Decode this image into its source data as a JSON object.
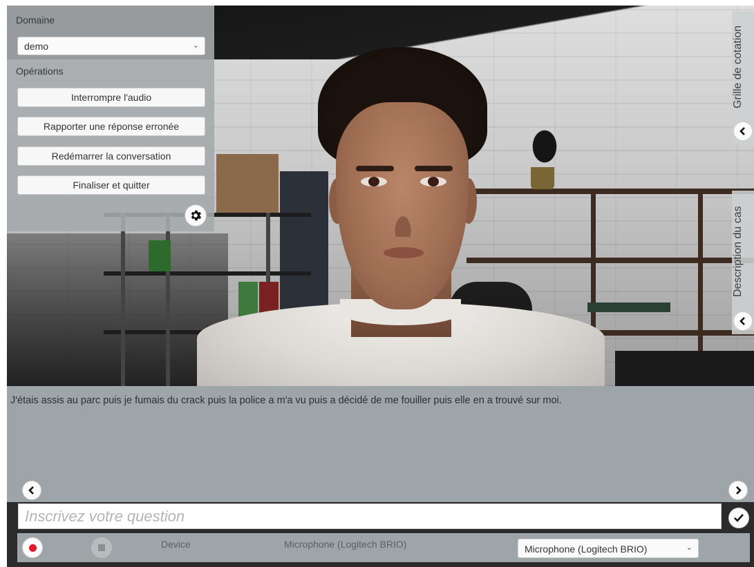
{
  "panel": {
    "domain_label": "Domaine",
    "domain_value": "demo",
    "operations_label": "Opérations",
    "buttons": {
      "interrupt": "Interrompre l'audio",
      "report": "Rapporter une réponse erronée",
      "restart": "Redémarrer la conversation",
      "finish": "Finaliser et quitter"
    },
    "settings_icon": "gear-icon"
  },
  "side_tabs": {
    "grading": "Grille de cotation",
    "case_description": "Description du cas",
    "collapse_icon": "chevron-left-icon"
  },
  "transcript": {
    "text": "J'étais assis au parc puis je fumais du crack puis la police a m'a vu puis a décidé de me fouiller puis elle en a trouvé sur moi.",
    "prev_icon": "chevron-left-icon",
    "next_icon": "chevron-right-icon"
  },
  "question": {
    "placeholder": "Inscrivez votre question",
    "submit_icon": "checkmark-icon"
  },
  "audio_bar": {
    "record_icon": "record-icon",
    "stop_icon": "stop-icon",
    "device_label": "Device",
    "device_name": "Microphone (Logitech BRIO)",
    "device_select_value": "Microphone (Logitech BRIO)"
  },
  "colors": {
    "panel_bg": "#a5aaac",
    "transcript_bg": "#9da5a8",
    "record_red": "#e0182a"
  }
}
